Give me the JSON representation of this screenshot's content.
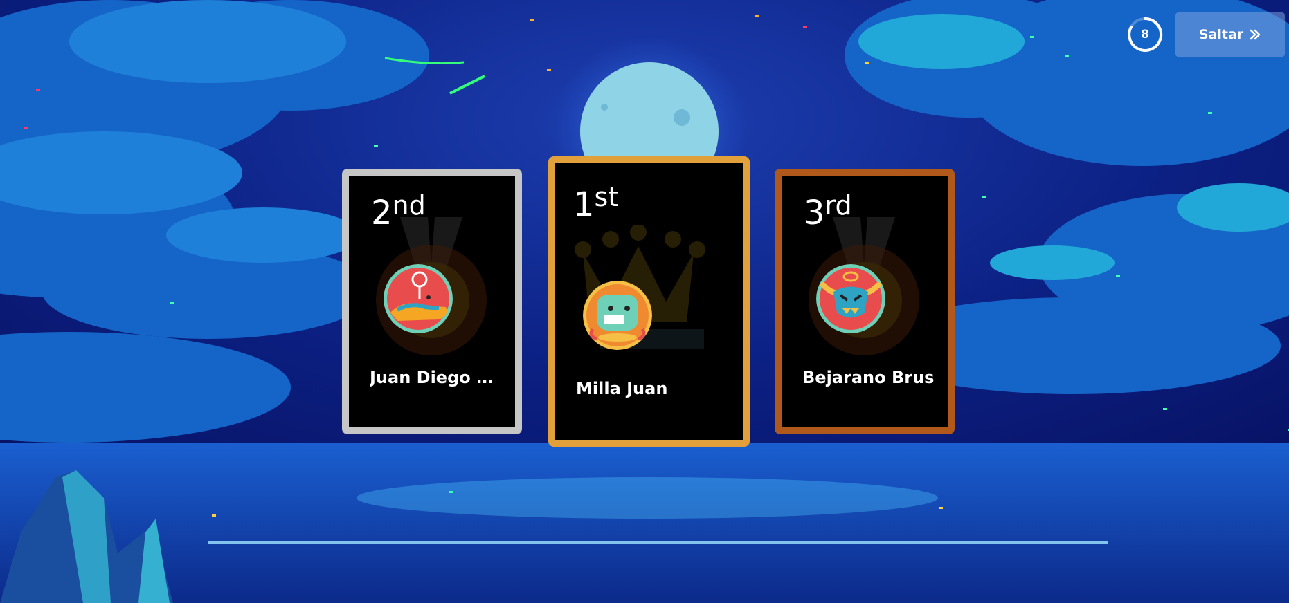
{
  "timer": {
    "value": "8"
  },
  "skip_button": {
    "label": "Saltar"
  },
  "podium": [
    {
      "place_number": "2",
      "place_suffix": "nd",
      "name": "Juan Diego P...",
      "avatar": "shoe-monster-avatar"
    },
    {
      "place_number": "1",
      "place_suffix": "st",
      "name": "Milla Juan",
      "avatar": "robot-monster-avatar"
    },
    {
      "place_number": "3",
      "place_suffix": "rd",
      "name": "Bejarano Brus",
      "avatar": "horned-monster-avatar"
    }
  ],
  "colors": {
    "silver": "#c6c6c6",
    "gold": "#e1a03a",
    "bronze": "#b1591b"
  }
}
